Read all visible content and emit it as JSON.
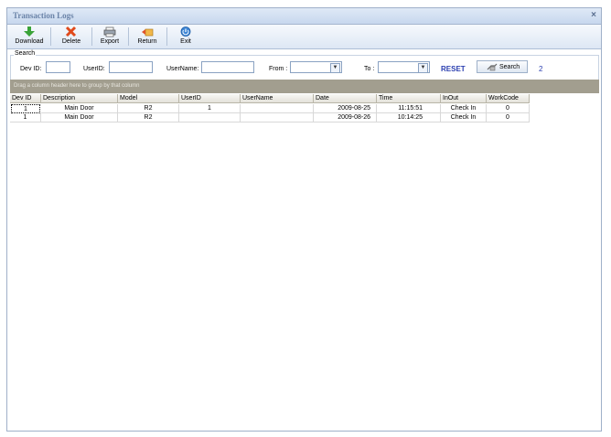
{
  "window": {
    "title": "Transaction Logs",
    "close": "×"
  },
  "toolbar": {
    "download": "Download",
    "delete": "Delete",
    "export": "Export",
    "return": "Return",
    "exit": "Exit"
  },
  "search": {
    "legend": "Search",
    "dev_id_label": "Dev ID:",
    "dev_id_value": "",
    "user_id_label": "UserID:",
    "user_id_value": "",
    "user_name_label": "UserName:",
    "user_name_value": "",
    "from_label": "From :",
    "from_value": "",
    "to_label": "To :",
    "to_value": "",
    "reset_label": "RESET",
    "search_label": "Search",
    "result_count": "2"
  },
  "grid": {
    "group_hint": "Drag a column header here to group by that column",
    "columns": [
      "Dev ID",
      "Description",
      "Model",
      "UserID",
      "UserName",
      "Date",
      "Time",
      "InOut",
      "WorkCode"
    ],
    "rows": [
      [
        "1",
        "Main Door",
        "R2",
        "1",
        "",
        "2009-08-25",
        "11:15:51",
        "Check In",
        "0"
      ],
      [
        "1",
        "Main Door",
        "R2",
        "",
        "",
        "2009-08-26",
        "10:14:25",
        "Check In",
        "0"
      ]
    ]
  }
}
